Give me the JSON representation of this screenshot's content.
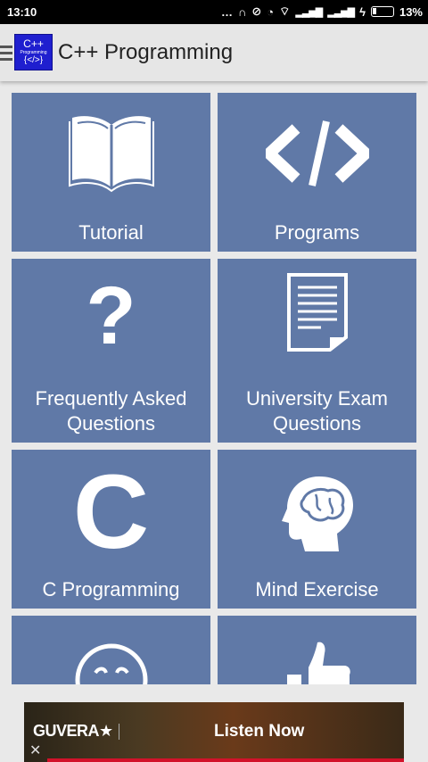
{
  "status": {
    "time": "13:10",
    "battery": "13%"
  },
  "appbar": {
    "logo_line1": "C++",
    "logo_line2": "Programming",
    "logo_line3": "{</>}",
    "title": "C++ Programming"
  },
  "tiles": [
    {
      "label_1": "Tutorial",
      "label_2": "",
      "icon": "open-book-icon"
    },
    {
      "label_1": "Programs",
      "label_2": "",
      "icon": "code-brackets-icon"
    },
    {
      "label_1": "Frequently Asked",
      "label_2": "Questions",
      "icon": "question-mark-icon"
    },
    {
      "label_1": "University Exam",
      "label_2": "Questions",
      "icon": "document-icon"
    },
    {
      "label_1": "C Programming",
      "label_2": "",
      "icon": "letter-c-icon"
    },
    {
      "label_1": "Mind Exercise",
      "label_2": "",
      "icon": "brain-head-icon"
    },
    {
      "label_1": "",
      "label_2": "",
      "icon": "smiley-icon"
    },
    {
      "label_1": "",
      "label_2": "",
      "icon": "thumbs-up-icon"
    }
  ],
  "ad": {
    "brand": "GUVERA★",
    "cta": "Listen Now",
    "close": "✕"
  },
  "colors": {
    "tile_bg": "#6079a7",
    "accent_logo": "#1f1fcf",
    "ad_bar": "#d2122a"
  }
}
